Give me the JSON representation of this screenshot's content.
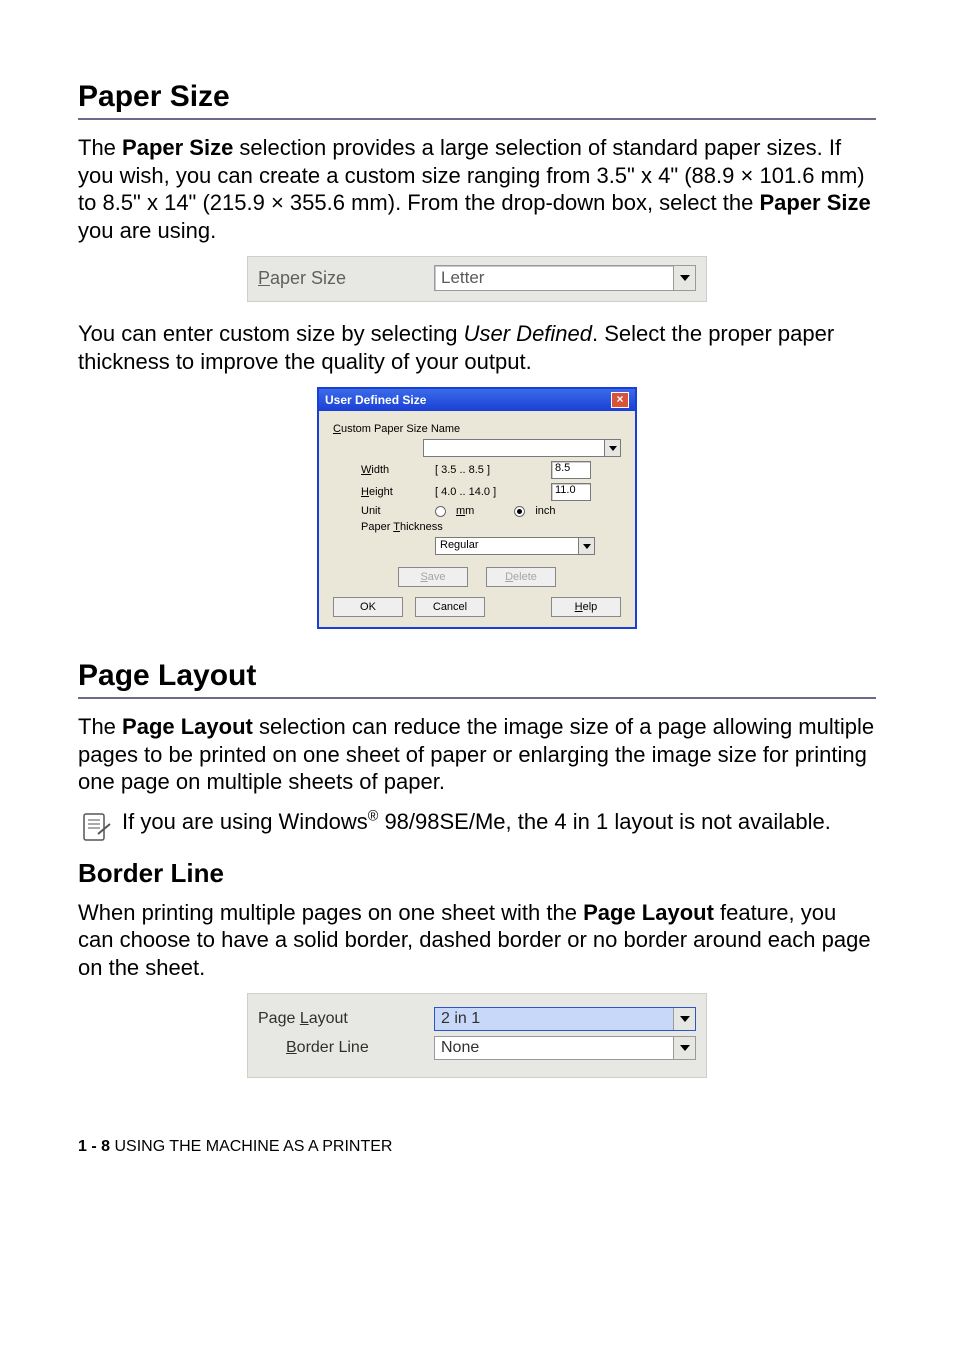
{
  "sections": {
    "paper_size": {
      "heading": "Paper Size",
      "para1_a": "The ",
      "para1_b": "Paper Size",
      "para1_c": " selection provides a large selection of standard paper sizes. If you wish, you can create a custom size ranging from 3.5\" x 4\" (88.9 × 101.6 mm) to 8.5\" x 14\" (215.9 × 355.6 mm). From the drop-down box, select the ",
      "para1_d": "Paper Size",
      "para1_e": " you are using.",
      "row_label_pre": "P",
      "row_label_rest": "aper Size",
      "row_value": "Letter",
      "para2_a": "You can enter custom size by selecting ",
      "para2_b": "User Defined",
      "para2_c": ". Select the proper paper thickness to improve the quality of your output."
    },
    "dialog": {
      "title": "User Defined Size",
      "name_label_pre": "C",
      "name_label_rest": "ustom Paper Size Name",
      "width_pre": "W",
      "width_rest": "idth",
      "width_range": "[ 3.5    ..   8.5     ]",
      "width_value": "8.5",
      "height_pre": "H",
      "height_rest": "eight",
      "height_range": "[ 4.0    ..   14.0    ]",
      "height_value": "11.0",
      "unit_label": "Unit",
      "unit_mm_pre": "m",
      "unit_mm_rest": "m",
      "unit_inch": "inch",
      "thickness_label_a": "Paper ",
      "thickness_pre": "T",
      "thickness_rest": "hickness",
      "thickness_value": "Regular",
      "save_pre": "S",
      "save_rest": "ave",
      "delete_pre": "D",
      "delete_rest": "elete",
      "ok": "OK",
      "cancel": "Cancel",
      "help_pre": "H",
      "help_rest": "elp"
    },
    "page_layout": {
      "heading": "Page Layout",
      "para_a": "The ",
      "para_b": "Page Layout",
      "para_c": " selection can reduce the image size of a page allowing multiple pages to be printed on one sheet of paper or enlarging the image size for printing one page on multiple sheets of paper.",
      "note_a": "If you are using Windows",
      "note_sup": "®",
      "note_b": " 98/98SE/Me, the 4 in 1 layout is not available.",
      "sub_heading": "Border Line",
      "para2_a": "When printing multiple pages on one sheet with the ",
      "para2_b": "Page Layout",
      "para2_c": " feature, you can choose to have a solid border, dashed border or no border around each page on the sheet.",
      "row1_label_a": "Page ",
      "row1_pre": "L",
      "row1_rest": "ayout",
      "row1_value": "2 in 1",
      "row2_pre": "B",
      "row2_rest": "order Line",
      "row2_value": "None"
    },
    "footer": {
      "page": "1 - 8",
      "chapter": "   USING THE MACHINE AS A PRINTER"
    }
  }
}
